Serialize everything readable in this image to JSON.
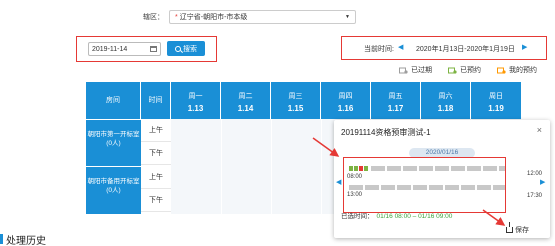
{
  "region": {
    "label": "辖区：",
    "required_mark": "*",
    "value": "辽宁省-朝阳市-市本级"
  },
  "search": {
    "date_value": "2019-11-14",
    "button_label": "搜索"
  },
  "time_nav": {
    "label": "当前时间:",
    "prev": "◀",
    "range": "2020年1月13日-2020年1月19日",
    "next": "▶"
  },
  "legend": [
    {
      "label": "已过期",
      "color": "#9e9e9e",
      "icon": "expired-icon"
    },
    {
      "label": "已预约",
      "color": "#7cb342",
      "icon": "booked-icon"
    },
    {
      "label": "我的预约",
      "color": "#ff9800",
      "icon": "my-booking-icon"
    }
  ],
  "table": {
    "room_header": "房间",
    "time_header": "时间",
    "days": [
      {
        "weekday": "周一",
        "date": "1.13"
      },
      {
        "weekday": "周二",
        "date": "1.14"
      },
      {
        "weekday": "周三",
        "date": "1.15"
      },
      {
        "weekday": "周四",
        "date": "1.16"
      },
      {
        "weekday": "周五",
        "date": "1.17"
      },
      {
        "weekday": "周六",
        "date": "1.18"
      },
      {
        "weekday": "周日",
        "date": "1.19"
      }
    ],
    "rooms": [
      {
        "name": "朝阳市第一开标室",
        "count": "(0人)",
        "am": "上午",
        "pm": "下午"
      },
      {
        "name": "朝阳市备用开标室",
        "count": "(0人)",
        "am": "上午",
        "pm": "下午"
      }
    ]
  },
  "popup": {
    "title": "20191114资格预审测试-1",
    "close": "×",
    "date": "2020/01/16",
    "prev": "◀",
    "next": "▶",
    "t_start_am": "08:00",
    "t_end_am": "12:00",
    "t_start_pm": "13:00",
    "t_end_pm": "17:30",
    "chosen_label": "已选时间：",
    "chosen_value": "01/16 08:00 – 01/16 09:00",
    "save_label": "保存"
  },
  "history": {
    "title": "处理历史"
  },
  "colors": {
    "accent": "#1a8fd6",
    "highlight": "#e53935",
    "booked": "#7cb342"
  }
}
